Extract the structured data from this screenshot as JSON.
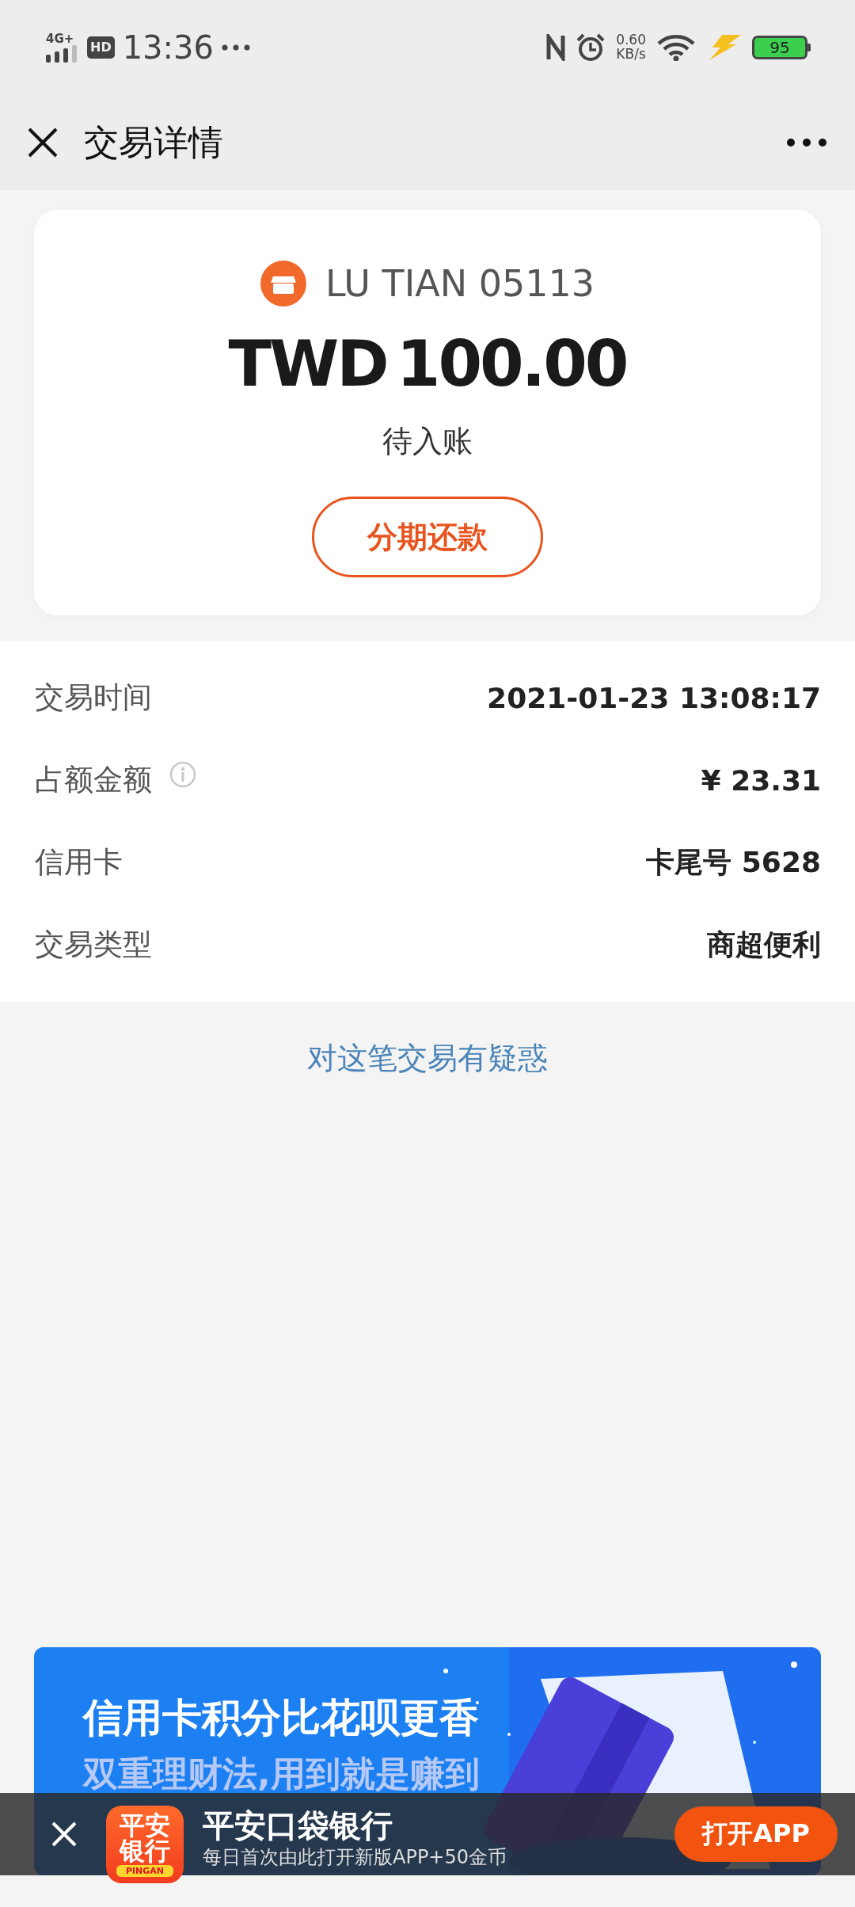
{
  "status_bar": {
    "network": "4G+",
    "hd": "HD",
    "time": "13:36",
    "speed_value": "0.60",
    "speed_unit": "KB/s",
    "battery": "95"
  },
  "nav": {
    "title": "交易详情"
  },
  "card": {
    "merchant": "LU TIAN 05113",
    "currency": "TWD",
    "amount": "100.00",
    "status": "待入账",
    "button": "分期还款"
  },
  "details": [
    {
      "label": "交易时间",
      "value": "2021-01-23 13:08:17",
      "info": false
    },
    {
      "label": "占额金额",
      "value": "¥ 23.31",
      "info": true
    },
    {
      "label": "信用卡",
      "value": "卡尾号 5628",
      "info": false
    },
    {
      "label": "交易类型",
      "value": "商超便利",
      "info": false
    }
  ],
  "help_link": "对这笔交易有疑惑",
  "banner": {
    "headline": "信用卡积分比花呗更香",
    "subline": "双重理财法,用到就是赚到"
  },
  "app_prompt": {
    "logo_top": "平安",
    "logo_bottom": "银行",
    "logo_brand": "PINGAN",
    "name": "平安口袋银行",
    "tagline": "每日首次由此打开新版APP+50金币",
    "button": "打开APP"
  }
}
